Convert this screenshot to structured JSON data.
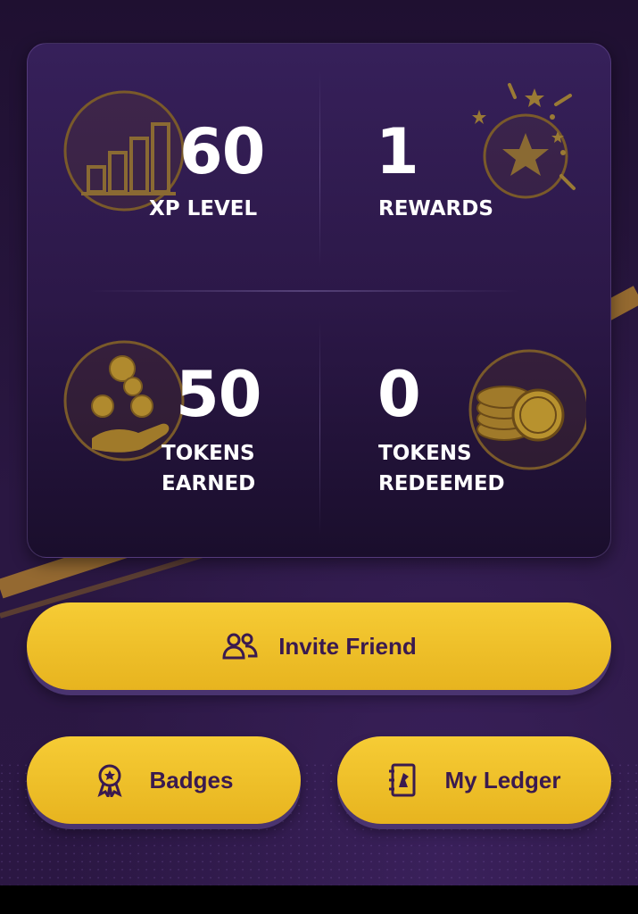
{
  "stats": {
    "xp": {
      "value": "60",
      "label": "XP LEVEL",
      "icon": "bar-chart-icon"
    },
    "rewards": {
      "value": "1",
      "label": "REWARDS",
      "icon": "star-burst-icon"
    },
    "tokens_earned": {
      "value": "50",
      "label_line1": "TOKENS",
      "label_line2": "EARNED",
      "icon": "coins-hand-icon"
    },
    "tokens_redeemed": {
      "value": "0",
      "label_line1": "TOKENS",
      "label_line2": "REDEEMED",
      "icon": "coin-stack-icon"
    }
  },
  "buttons": {
    "invite": {
      "label": "Invite Friend",
      "icon": "users-icon"
    },
    "badges": {
      "label": "Badges",
      "icon": "badge-icon"
    },
    "ledger": {
      "label": "My Ledger",
      "icon": "ledger-book-icon"
    }
  },
  "colors": {
    "background": "#241338",
    "card": "#2c1848",
    "accent_gold": "#f2c12e",
    "button_text": "#3a1a4f",
    "icon_gold": "#a07a2a"
  }
}
